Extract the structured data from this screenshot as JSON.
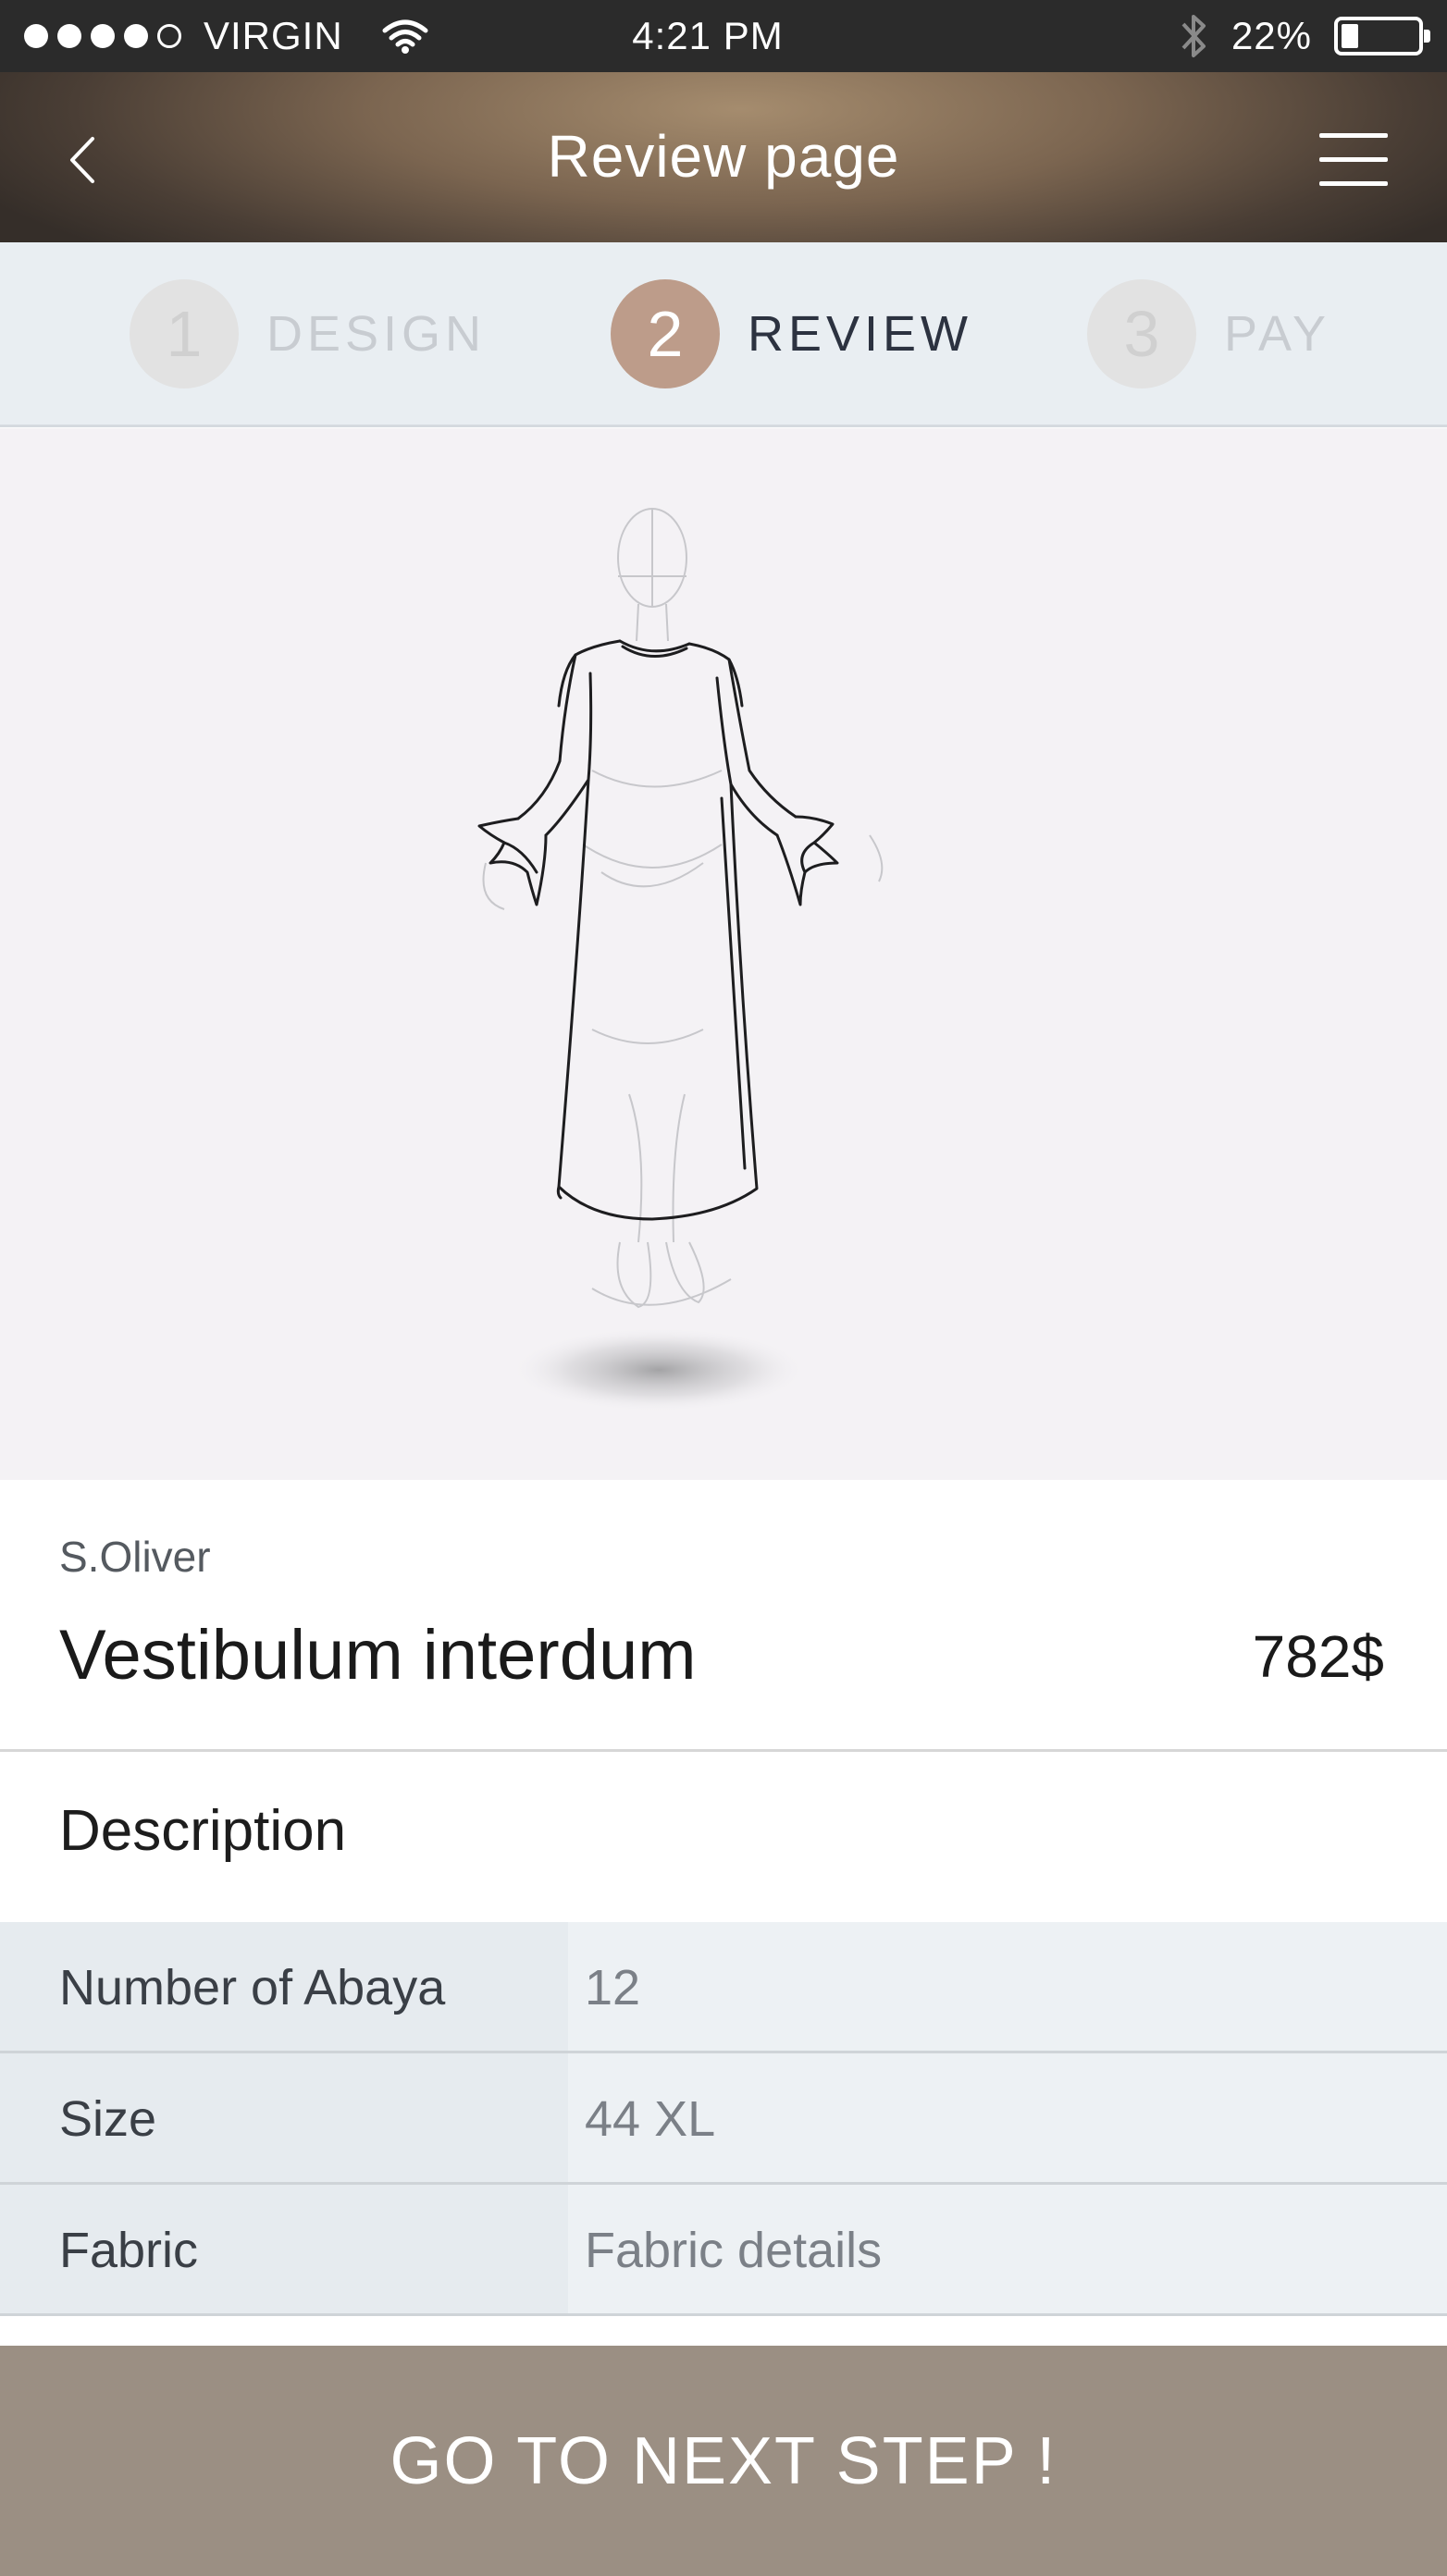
{
  "status_bar": {
    "carrier": "VIRGIN",
    "time": "4:21 PM",
    "battery": "22%",
    "battery_level": 0.22,
    "signal_dots_filled": 4,
    "signal_dots_total": 5
  },
  "header": {
    "title": "Review page",
    "back_icon": "chevron-left-icon",
    "menu_icon": "hamburger-menu-icon"
  },
  "steps": [
    {
      "number": "1",
      "label": "DESIGN",
      "state": "inactive"
    },
    {
      "number": "2",
      "label": "REVIEW",
      "state": "active"
    },
    {
      "number": "3",
      "label": "PAY",
      "state": "inactive"
    }
  ],
  "product": {
    "brand": "S.Oliver",
    "name": "Vestibulum interdum",
    "price": "782$"
  },
  "description": {
    "title": "Description",
    "rows": [
      {
        "label": "Number of Abaya",
        "value": "12"
      },
      {
        "label": "Size",
        "value": "44 XL"
      },
      {
        "label": "Fabric",
        "value": "Fabric details"
      }
    ]
  },
  "cta": {
    "label": "GO TO NEXT STEP !"
  },
  "colors": {
    "accent": "#bd9c8a",
    "cta_bg": "#9b8f83",
    "steps_bg": "#e9eef2"
  }
}
